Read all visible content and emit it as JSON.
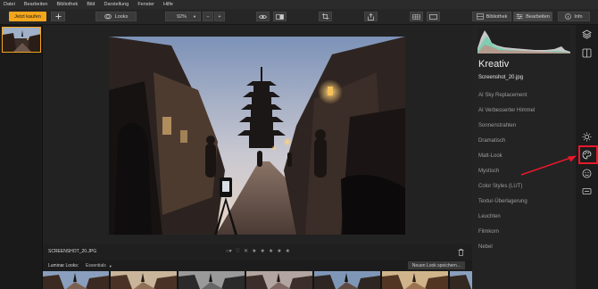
{
  "menu": [
    "Datei",
    "Bearbeiten",
    "Bibliothek",
    "Bild",
    "Darstellung",
    "Fenster",
    "Hilfe"
  ],
  "toolbar": {
    "buy_label": "Jetzt kaufen",
    "add_icon": "plus-icon",
    "looks_label": "Looks",
    "zoom_value": "92%",
    "zoom_out": "−",
    "zoom_in": "+",
    "library_label": "Bibliothek",
    "edit_label": "Bearbeiten",
    "info_label": "Info"
  },
  "infobar": {
    "filename": "SCREENSHOT_20.JPG"
  },
  "looks": {
    "label": "Luminar Looks:",
    "selected": "Essentials",
    "save_label": "Neuen Look speichern..."
  },
  "panel": {
    "title": "Kreativ",
    "file": "Screenshot_20.jpg",
    "filters": [
      "AI Sky Replacement",
      "AI Verbesserter Himmel",
      "Sonnenstrahlen",
      "Dramatisch",
      "Matt-Look",
      "Mystisch",
      "Color Styles (LUT)",
      "Textur-Überlagerung",
      "Leuchten",
      "Filmkorn",
      "Nebel"
    ]
  },
  "rail_icons": [
    "layers-icon",
    "compare-icon",
    "sun-icon",
    "palette-icon",
    "smiley-icon",
    "pro-icon"
  ],
  "colors": {
    "accent": "#f3a51b",
    "highlight": "#e8182a"
  }
}
